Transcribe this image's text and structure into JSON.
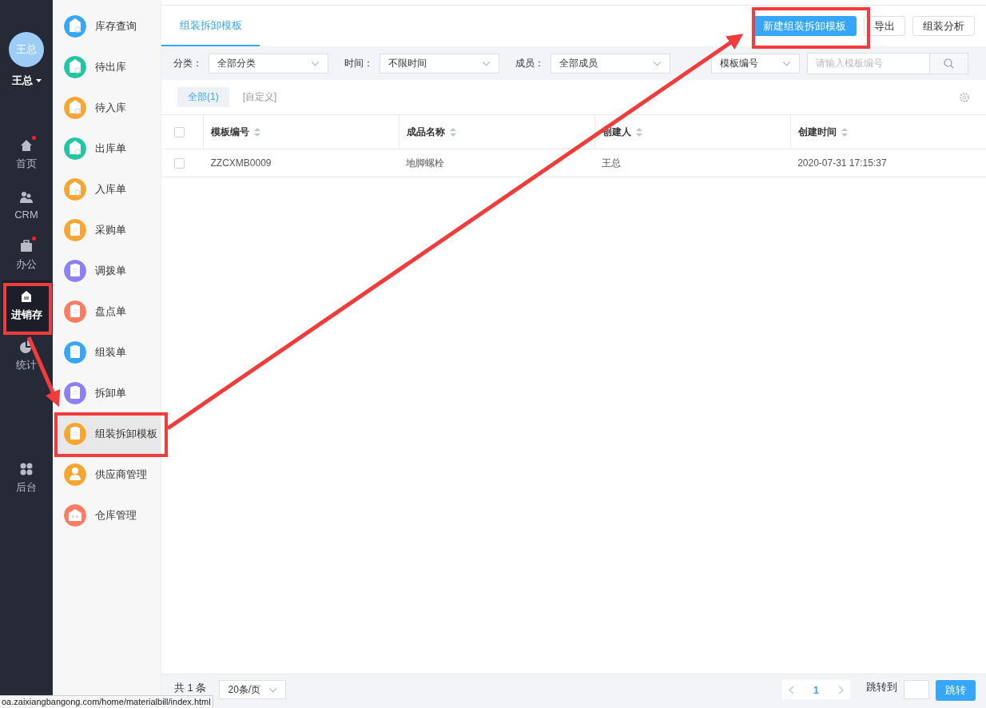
{
  "rail": {
    "avatar_text": "王总",
    "user_name": "王总",
    "items": [
      {
        "label": "首页",
        "kind": "home",
        "selected": false,
        "badge": true
      },
      {
        "label": "CRM",
        "kind": "people",
        "selected": false,
        "badge": false
      },
      {
        "label": "办公",
        "kind": "briefcase",
        "selected": false,
        "badge": true
      },
      {
        "label": "进销存",
        "kind": "box",
        "selected": true,
        "badge": false
      },
      {
        "label": "统计",
        "kind": "pie",
        "selected": false,
        "badge": false
      },
      {
        "label": "后台",
        "kind": "grid",
        "selected": false,
        "badge": false
      }
    ]
  },
  "submenu": [
    {
      "label": "库存查询",
      "kind": "house",
      "color": "#35a6f8",
      "selected": false
    },
    {
      "label": "待出库",
      "kind": "house",
      "color": "#21c7a2",
      "selected": false
    },
    {
      "label": "待入库",
      "kind": "house",
      "color": "#f8a531",
      "selected": false
    },
    {
      "label": "出库单",
      "kind": "house",
      "color": "#21c7a2",
      "selected": false
    },
    {
      "label": "入库单",
      "kind": "house",
      "color": "#f8a531",
      "selected": false
    },
    {
      "label": "采购单",
      "kind": "clipboard",
      "color": "#f8a531",
      "selected": false
    },
    {
      "label": "调拨单",
      "kind": "clipboard",
      "color": "#8c80f6",
      "selected": false
    },
    {
      "label": "盘点单",
      "kind": "clipboard",
      "color": "#fd7c62",
      "selected": false
    },
    {
      "label": "组装单",
      "kind": "clipboard",
      "color": "#35a6f8",
      "selected": false
    },
    {
      "label": "拆卸单",
      "kind": "clipboard",
      "color": "#8c80f6",
      "selected": false
    },
    {
      "label": "组装拆卸模板",
      "kind": "clipboard",
      "color": "#f8a531",
      "selected": true
    },
    {
      "label": "供应商管理",
      "kind": "person",
      "color": "#f8a531",
      "selected": false
    },
    {
      "label": "仓库管理",
      "kind": "building",
      "color": "#fd7c62",
      "selected": false
    }
  ],
  "page_tab": "组装拆卸模板",
  "buttons": [
    {
      "label": "新建组装拆卸模板",
      "kind": "primary"
    },
    {
      "label": "导出",
      "kind": "plain"
    },
    {
      "label": "组装分析",
      "kind": "plain"
    }
  ],
  "filters": [
    {
      "label": "分类：",
      "value": "全部分类"
    },
    {
      "label": "时间：",
      "value": "不限时间"
    },
    {
      "label": "成员：",
      "value": "全部成员"
    }
  ],
  "search": {
    "field": "模板编号",
    "placeholder": "请输入模板编号"
  },
  "view_tabs": [
    {
      "label": "全部(1)",
      "selected": true
    },
    {
      "label": "[自定义]",
      "selected": false
    }
  ],
  "table": {
    "header_checked": false,
    "columns": [
      "模板编号",
      "成品名称",
      "创建人",
      "创建时间"
    ],
    "rows": [
      {
        "checked": false,
        "cells": [
          "ZZCXMB0009",
          "地脚螺栓",
          "王总",
          "2020-07-31 17:15:37"
        ]
      }
    ]
  },
  "footer": {
    "total": "共 1 条",
    "page_size": "20条/页",
    "page": "1",
    "jump_label": "跳转到",
    "jump_button": "跳转"
  },
  "status_url": "oa.zaixiangbangong.com/home/materialbill/index.html"
}
